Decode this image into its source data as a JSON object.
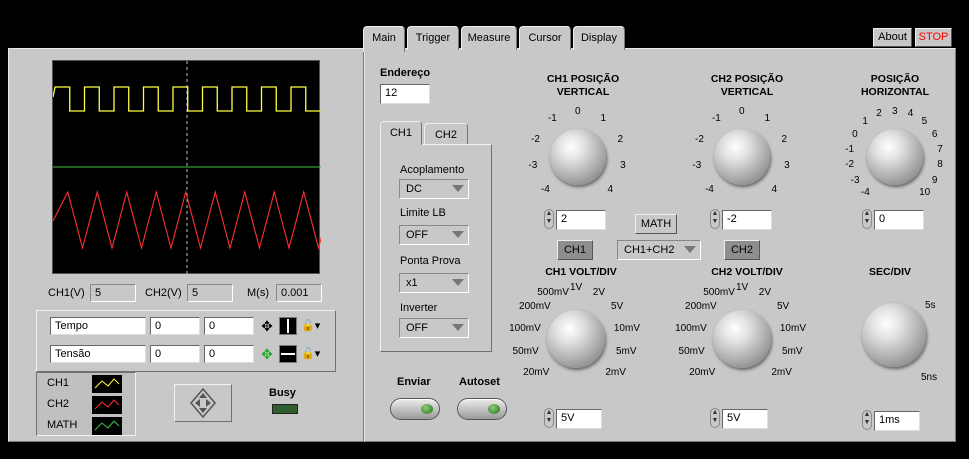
{
  "tabs": [
    "Main",
    "Trigger",
    "Measure",
    "Cursor",
    "Display"
  ],
  "top_buttons": {
    "about": "About",
    "stop": "STOP"
  },
  "readouts": {
    "ch1_label": "CH1(V)",
    "ch1_value": "5",
    "ch2_label": "CH2(V)",
    "ch2_value": "5",
    "m_label": "M(s)",
    "m_value": "0.001"
  },
  "cursors": [
    {
      "name": "Tempo",
      "v1": "0",
      "v2": "0"
    },
    {
      "name": "Tensão",
      "v1": "0",
      "v2": "0"
    }
  ],
  "legend": [
    "CH1",
    "CH2",
    "MATH"
  ],
  "busy_label": "Busy",
  "endereco": {
    "label": "Endereço",
    "value": "12"
  },
  "channel_tabs": [
    "CH1",
    "CH2"
  ],
  "channel_settings": {
    "acoplamento_label": "Acoplamento",
    "acoplamento_value": "DC",
    "limite_label": "Limite LB",
    "limite_value": "OFF",
    "ponta_label": "Ponta Prova",
    "ponta_value": "x1",
    "inverter_label": "Inverter",
    "inverter_value": "OFF"
  },
  "actions": {
    "enviar": "Enviar",
    "autoset": "Autoset"
  },
  "ch1_pos": {
    "title1": "CH1 POSIÇÃO",
    "title2": "VERTICAL",
    "value": "2"
  },
  "ch2_pos": {
    "title1": "CH2 POSIÇÃO",
    "title2": "VERTICAL",
    "value": "-2"
  },
  "h_pos": {
    "title1": "POSIÇÃO",
    "title2": "HORIZONTAL",
    "value": "0"
  },
  "pos_scale": [
    "-4",
    "-3",
    "-2",
    "-1",
    "0",
    "1",
    "2",
    "3",
    "4"
  ],
  "hpos_scale": [
    "-4",
    "-3",
    "-2",
    "-1",
    "0",
    "1",
    "2",
    "3",
    "4",
    "5",
    "6",
    "7",
    "8",
    "9",
    "10"
  ],
  "math": {
    "label": "MATH",
    "ch1": "CH1",
    "ch2": "CH2",
    "mode": "CH1+CH2"
  },
  "ch1_volt": {
    "title": "CH1 VOLT/DIV",
    "value": "5V"
  },
  "ch2_volt": {
    "title": "CH2 VOLT/DIV",
    "value": "5V"
  },
  "volt_scale": [
    "20mV",
    "50mV",
    "100mV",
    "200mV",
    "500mV",
    "1V",
    "2V",
    "5V",
    "10mV",
    "5mV",
    "2mV"
  ],
  "sec_div": {
    "title": "SEC/DIV",
    "value": "1ms",
    "max": "5s",
    "min": "5ns"
  },
  "colors": {
    "ch1": "#ffff40",
    "ch2": "#40c040",
    "math": "#ff3030",
    "stop": "#ff0000"
  }
}
